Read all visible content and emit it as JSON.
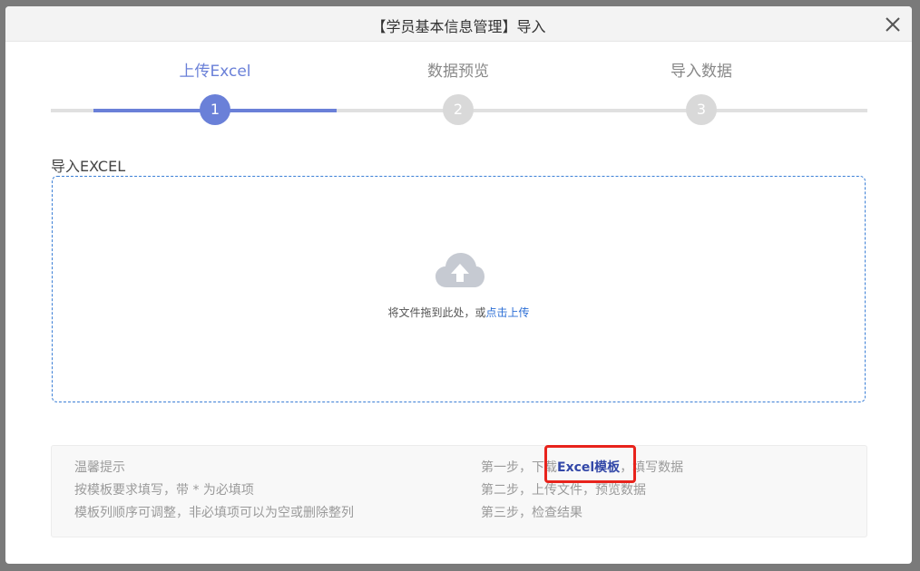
{
  "dialog": {
    "title": "【学员基本信息管理】导入",
    "close_icon": "close-icon"
  },
  "steps": [
    {
      "label": "上传Excel",
      "number": "1",
      "active": true
    },
    {
      "label": "数据预览",
      "number": "2",
      "active": false
    },
    {
      "label": "导入数据",
      "number": "3",
      "active": false
    }
  ],
  "upload": {
    "section_label": "导入EXCEL",
    "icon": "cloud-upload-icon",
    "hint_text": "将文件拖到此处，或",
    "link_text": "点击上传"
  },
  "tips": {
    "title": "温馨提示",
    "line1": "按模板要求填写，带 * 为必填项",
    "line2": "模板列顺序可调整，非必填项可以为空或删除整列",
    "step1_prefix": "第一步，下载",
    "step1_link": "Excel模板",
    "step1_suffix": "，填写数据",
    "step2": "第二步，上传文件，预览数据",
    "step3": "第三步，检查结果"
  },
  "colors": {
    "accent": "#6a80d8",
    "link": "#2d6fd6",
    "highlight": "#e8231c"
  }
}
